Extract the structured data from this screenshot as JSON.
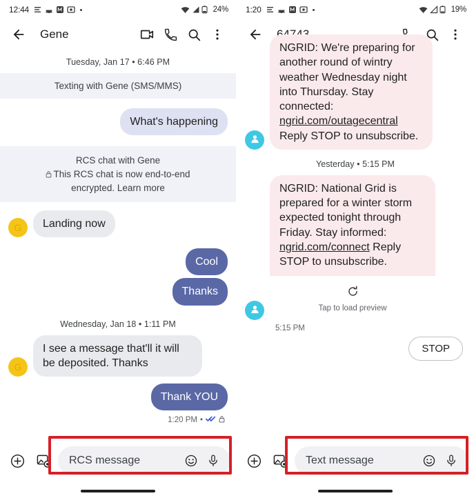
{
  "left_phone": {
    "status_bar": {
      "clock": "12:44",
      "battery_percent": "24%",
      "icons": [
        "menu-lines-icon",
        "food-icon",
        "app-icon",
        "photo-icon",
        "more-dot-icon"
      ],
      "right_icons": [
        "wifi-icon",
        "signal-icon",
        "battery-icon"
      ]
    },
    "app_bar": {
      "back_icon": "back-arrow-icon",
      "title": "Gene",
      "actions": [
        "video-call-icon",
        "phone-call-icon",
        "search-icon",
        "overflow-menu-icon"
      ]
    },
    "thread": [
      {
        "kind": "day_divider",
        "text": "Tuesday, Jan 17 • 6:46 PM"
      },
      {
        "kind": "banner",
        "text": "Texting with Gene (SMS/MMS)"
      },
      {
        "kind": "bubble_out_sms",
        "text": "What's happening"
      },
      {
        "kind": "banner_rcs",
        "line1": "RCS chat with Gene",
        "line2": "This RCS chat is now end-to-end",
        "line3": "encrypted.",
        "link": "Learn more",
        "lock_icon": "lock-icon"
      },
      {
        "kind": "bubble_in",
        "avatar": "G",
        "text": "Landing now"
      },
      {
        "kind": "bubble_out_rcs",
        "text": "Cool"
      },
      {
        "kind": "bubble_out_rcs",
        "text": "Thanks"
      },
      {
        "kind": "day_divider",
        "text": "Wednesday, Jan 18 • 1:11 PM"
      },
      {
        "kind": "bubble_in",
        "avatar": "G",
        "text": "I see a message that'll it will be deposited. Thanks"
      },
      {
        "kind": "bubble_out_rcs",
        "text": "Thank YOU"
      },
      {
        "kind": "meta",
        "time": "1:20 PM",
        "sep": "•",
        "icons": [
          "double-check-read-icon",
          "lock-icon"
        ]
      }
    ],
    "compose": {
      "add_icon": "plus-circle-icon",
      "gallery_icon": "gallery-camera-icon",
      "placeholder": "RCS message",
      "emoji_icon": "emoji-smiley-icon",
      "mic_icon": "microphone-icon",
      "highlighted": true
    }
  },
  "right_phone": {
    "status_bar": {
      "clock": "1:20",
      "battery_percent": "19%",
      "icons": [
        "menu-lines-icon",
        "food-icon",
        "app-icon",
        "photo-icon",
        "more-dot-icon"
      ],
      "right_icons": [
        "wifi-icon",
        "signal-icon",
        "battery-icon"
      ]
    },
    "app_bar": {
      "back_icon": "back-arrow-icon",
      "title": "64743",
      "actions": [
        "phone-call-icon",
        "search-icon",
        "overflow-menu-icon"
      ]
    },
    "thread": [
      {
        "kind": "bubble_in_pink_clipped",
        "avatar": "person-avatar-icon",
        "text_before": "NGRID: We're preparing for another round of wintry weather Wednesday night into Thursday. Stay connected: ",
        "link": "ngrid.com/outagecentral",
        "text_after": " Reply STOP to unsubscribe."
      },
      {
        "kind": "day_divider",
        "text": "Yesterday • 5:15 PM"
      },
      {
        "kind": "bubble_in_pink",
        "avatar": "person-avatar-icon",
        "text_before": "NGRID: National Grid is prepared for a winter storm expected tonight through Friday. Stay informed: ",
        "link": "ngrid.com/connect",
        "text_after": " Reply STOP to unsubscribe.",
        "preview": {
          "icon": "refresh-icon",
          "caption": "Tap to load preview"
        }
      },
      {
        "kind": "meta_left",
        "time": "5:15 PM"
      },
      {
        "kind": "suggestion_chip",
        "text": "STOP"
      }
    ],
    "compose": {
      "add_icon": "plus-circle-icon",
      "gallery_icon": "gallery-camera-icon",
      "placeholder": "Text message",
      "emoji_icon": "emoji-smiley-icon",
      "mic_icon": "microphone-icon",
      "highlighted": true
    }
  },
  "colors": {
    "rcs_sent_bubble": "#5a68a6",
    "sms_sent_bubble": "#dee1f2",
    "received_bubble": "#e8eaed",
    "sms_received_bubble": "#fbeaec",
    "banner_bg": "#f1f1f8",
    "highlight_red": "#d42026",
    "avatar_yellow": "#f4c518",
    "avatar_cyan": "#3fc8e4"
  }
}
